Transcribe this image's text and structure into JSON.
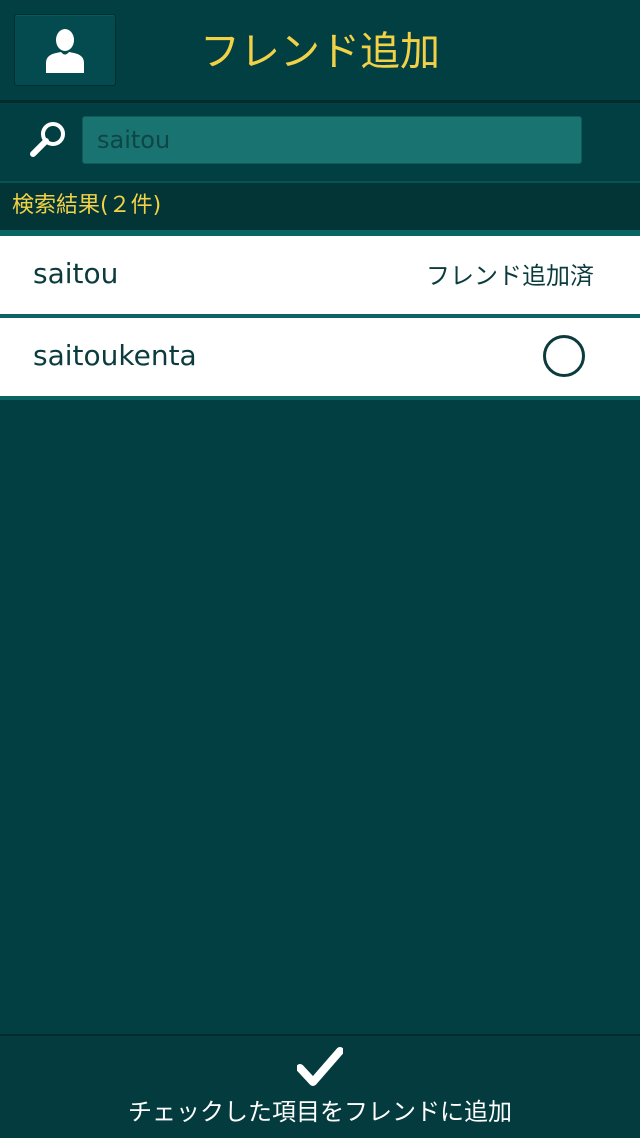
{
  "header": {
    "title": "フレンド追加",
    "profile_icon": "user-icon"
  },
  "search": {
    "value": "saitou",
    "icon": "search-icon"
  },
  "results": {
    "label": "検索結果(２件)",
    "items": [
      {
        "name": "saitou",
        "status": "フレンド追加済"
      },
      {
        "name": "saitoukenta",
        "status": ""
      }
    ]
  },
  "footer": {
    "label": "チェックした項目をフレンドに追加",
    "icon": "check-icon"
  },
  "colors": {
    "background": "#023f42",
    "accent": "#f2d147",
    "search_field": "#197371",
    "row": "#ffffff"
  }
}
